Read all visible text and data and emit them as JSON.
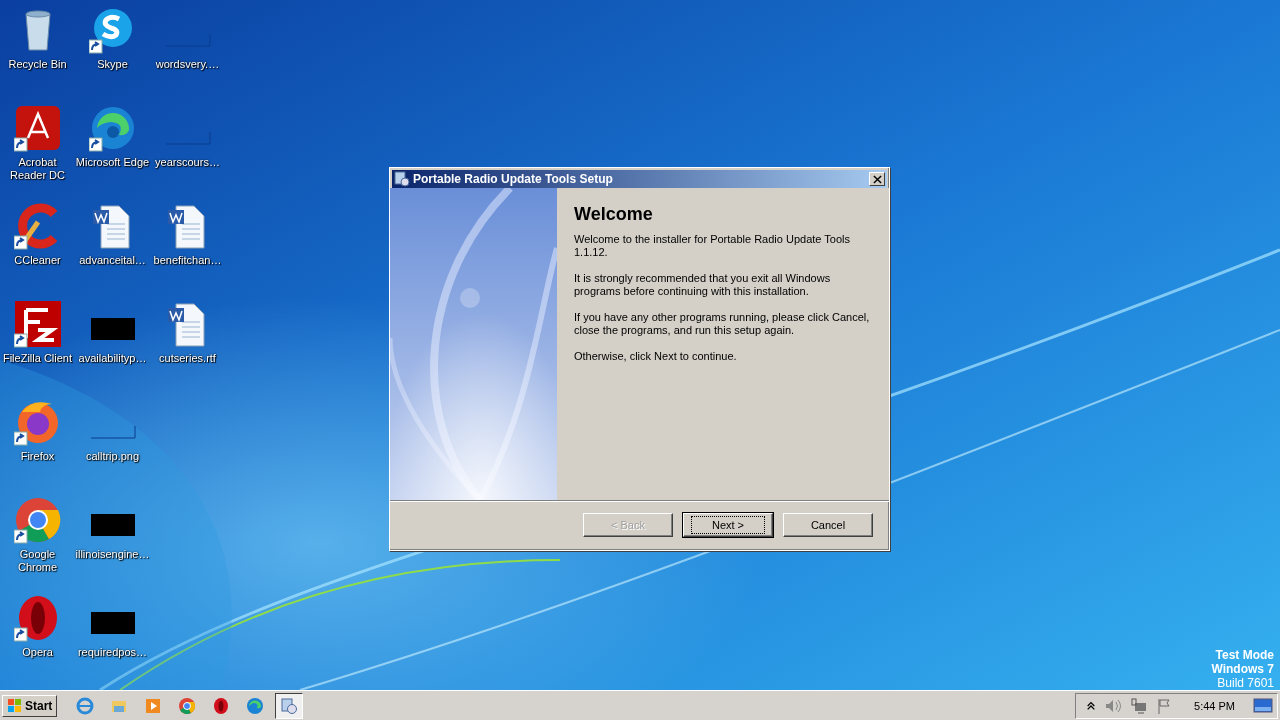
{
  "desktop_icons": [
    {
      "label": "Recycle Bin",
      "kind": "recycle",
      "shortcut": false
    },
    {
      "label": "Acrobat Reader DC",
      "kind": "acrobat",
      "shortcut": true
    },
    {
      "label": "CCleaner",
      "kind": "ccleaner",
      "shortcut": true
    },
    {
      "label": "FileZilla Client",
      "kind": "filezilla",
      "shortcut": true
    },
    {
      "label": "Firefox",
      "kind": "firefox",
      "shortcut": true
    },
    {
      "label": "Google Chrome",
      "kind": "chrome",
      "shortcut": true
    },
    {
      "label": "Opera",
      "kind": "opera",
      "shortcut": true
    },
    {
      "label": "Skype",
      "kind": "skype",
      "shortcut": true
    },
    {
      "label": "Microsoft Edge",
      "kind": "edge",
      "shortcut": true
    },
    {
      "label": "advanceital…",
      "kind": "word",
      "shortcut": false
    },
    {
      "label": "availabilityp…",
      "kind": "black",
      "shortcut": false
    },
    {
      "label": "calltrip.png",
      "kind": "blank",
      "shortcut": false
    },
    {
      "label": "illinoisengine…",
      "kind": "black",
      "shortcut": false
    },
    {
      "label": "requiredpos…",
      "kind": "black",
      "shortcut": false
    },
    {
      "label": "wordsvery.…",
      "kind": "blank",
      "shortcut": false
    },
    {
      "label": "yearscours…",
      "kind": "blank",
      "shortcut": false
    },
    {
      "label": "benefitchan…",
      "kind": "word",
      "shortcut": false
    },
    {
      "label": "cutseries.rtf",
      "kind": "word",
      "shortcut": false
    }
  ],
  "dialog": {
    "title": "Portable Radio Update Tools Setup",
    "heading": "Welcome",
    "paragraphs": [
      "Welcome to the installer for Portable Radio Update Tools 1.1.12.",
      "It is strongly recommended that you exit all Windows programs before continuing with this installation.",
      "If you have any other programs running, please click Cancel, close the programs, and run this setup again.",
      "Otherwise, click Next to continue."
    ],
    "buttons": [
      {
        "label": "< Back",
        "disabled": true,
        "default": false
      },
      {
        "label": "Next >",
        "disabled": false,
        "default": true
      },
      {
        "label": "Cancel",
        "disabled": false,
        "default": false
      }
    ]
  },
  "test_mode": [
    "Test Mode",
    "Windows 7",
    "Build 7601"
  ],
  "taskbar": {
    "start": "Start",
    "apps": [
      {
        "kind": "ie",
        "selected": false
      },
      {
        "kind": "explorer",
        "selected": false
      },
      {
        "kind": "media",
        "selected": false
      },
      {
        "kind": "chrome",
        "selected": false
      },
      {
        "kind": "opera",
        "selected": false
      },
      {
        "kind": "edge",
        "selected": false
      },
      {
        "kind": "setup",
        "selected": true
      }
    ],
    "clock": "5:44 PM"
  }
}
